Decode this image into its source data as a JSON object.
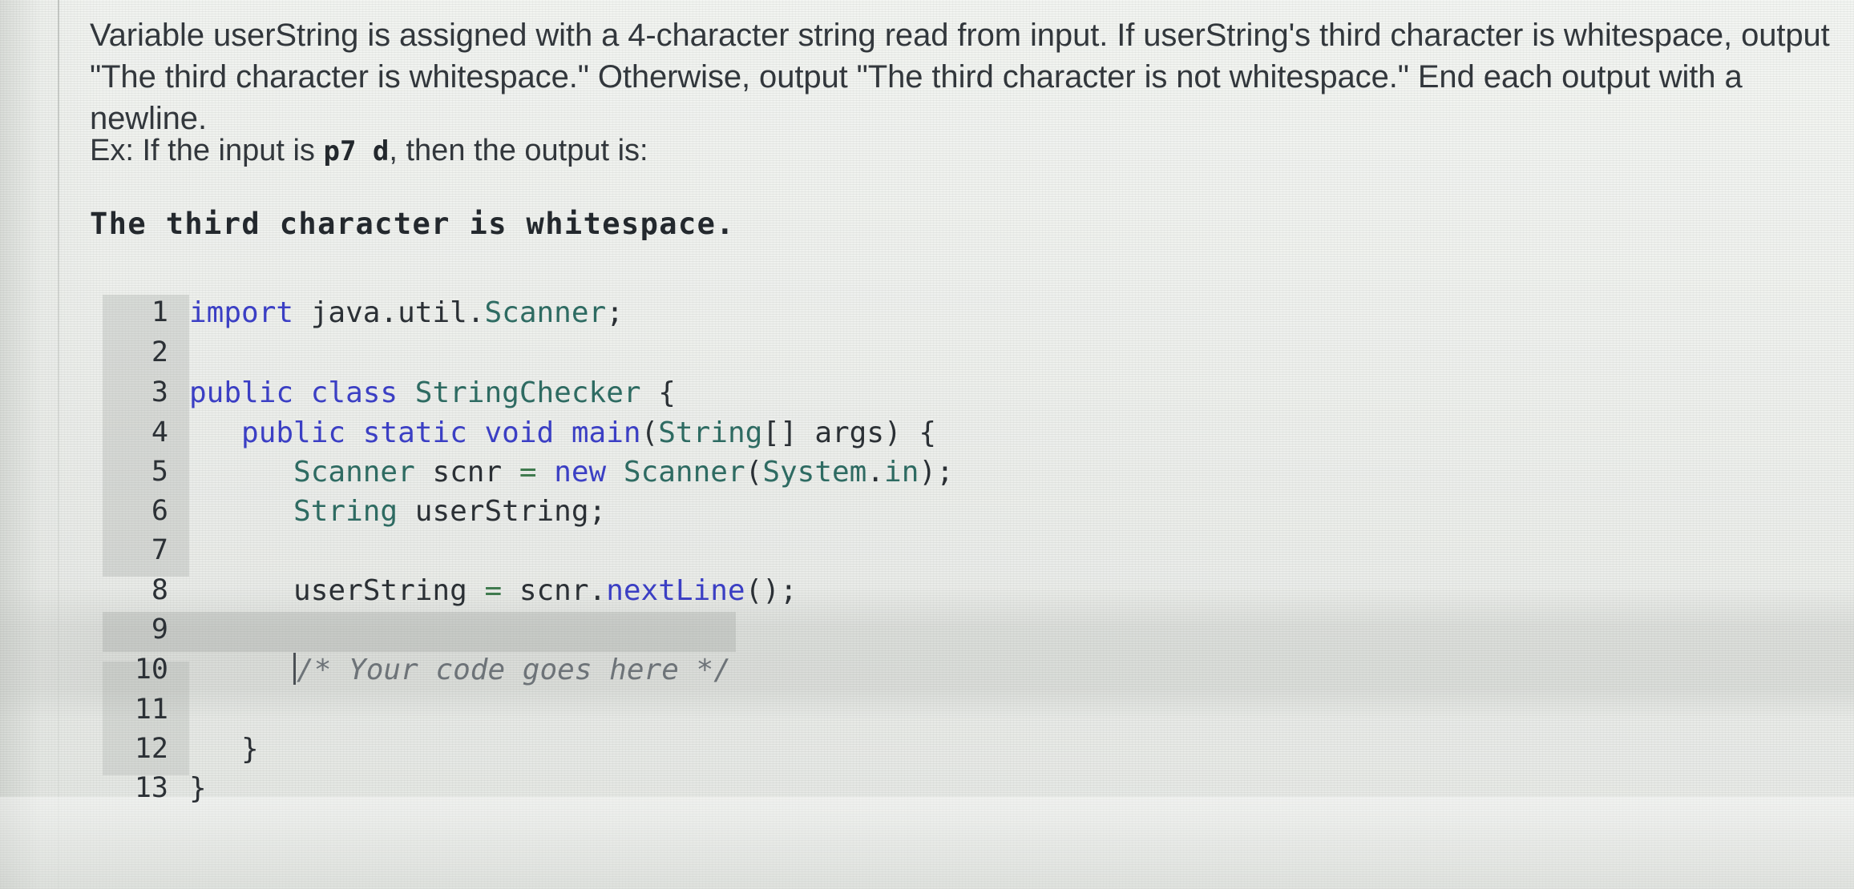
{
  "prompt": {
    "paragraph": "Variable userString is assigned with a 4-character string read from input. If userString's third character is whitespace, output \"The third character is whitespace.\" Otherwise, output \"The third character is not whitespace.\" End each output with a newline.",
    "example_prefix": "Ex: If the input is ",
    "example_input": "p7 d",
    "example_suffix": ", then the output is:",
    "example_output": "The third character is whitespace."
  },
  "editor": {
    "language": "java",
    "active_line": 10,
    "readonly_ranges": "1-8, 11-13",
    "lines": [
      {
        "n": "1",
        "text": "import java.util.Scanner;"
      },
      {
        "n": "2",
        "text": ""
      },
      {
        "n": "3",
        "text": "public class StringChecker {"
      },
      {
        "n": "4",
        "text": "    public static void main(String[] args) {"
      },
      {
        "n": "5",
        "text": "        Scanner scnr = new Scanner(System.in);"
      },
      {
        "n": "6",
        "text": "        String userString;"
      },
      {
        "n": "7",
        "text": ""
      },
      {
        "n": "8",
        "text": "        userString = scnr.nextLine();"
      },
      {
        "n": "9",
        "text": ""
      },
      {
        "n": "10",
        "text": "        /* Your code goes here */"
      },
      {
        "n": "11",
        "text": ""
      },
      {
        "n": "12",
        "text": "    }"
      },
      {
        "n": "13",
        "text": "}"
      }
    ],
    "line_numbers": [
      "1",
      "2",
      "3",
      "4",
      "5",
      "6",
      "7",
      "8",
      "9",
      "10",
      "11",
      "12",
      "13"
    ]
  },
  "colors": {
    "background": "#eef0ed",
    "body_text": "#32373c",
    "keyword": "#3b3fc4",
    "class_name": "#2e6b62",
    "method": "#3b3fc4",
    "comment": "#6d7378",
    "operator": "#3f7a4e",
    "gutter_shade": "rgba(150,155,150,.26)",
    "active_line": "rgba(150,155,150,.28)"
  }
}
